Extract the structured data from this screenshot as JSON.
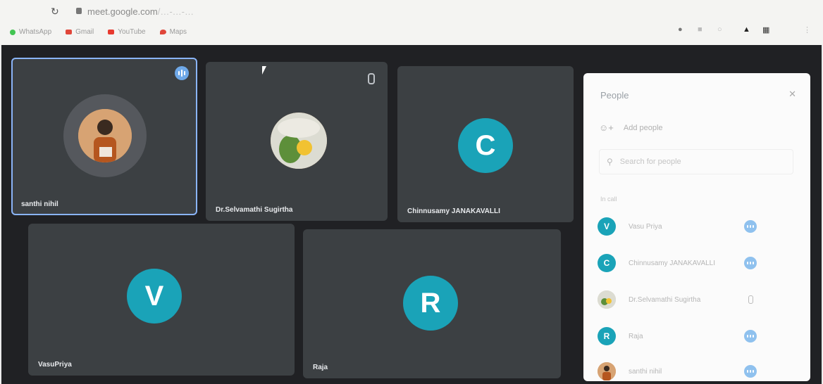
{
  "browser": {
    "url_host": "meet.google.com",
    "url_path": "/…-…-…",
    "bookmarks": [
      {
        "label": "WhatsApp",
        "color": "#43c553"
      },
      {
        "label": "Gmail",
        "color": "#e0463a"
      },
      {
        "label": "YouTube",
        "color": "#e83a2f"
      },
      {
        "label": "Maps",
        "color": "#e0463a"
      }
    ]
  },
  "tiles": [
    {
      "name": "santhi nihil",
      "kind": "photo",
      "speaking": true
    },
    {
      "name": "Dr.Selvamathi Sugirtha",
      "kind": "photo",
      "muted": true
    },
    {
      "name": "Chinnusamy JANAKAVALLI",
      "kind": "letter",
      "initial": "C"
    },
    {
      "name": "VasuPriya",
      "kind": "letter",
      "initial": "V"
    },
    {
      "name": "Raja",
      "kind": "letter",
      "initial": "R"
    }
  ],
  "people_panel": {
    "title": "People",
    "add_label": "Add people",
    "search_placeholder": "Search for people",
    "section_label": "In call",
    "participants": [
      {
        "initial": "V",
        "name": "Vasu Priya",
        "status": "speaking"
      },
      {
        "initial": "C",
        "name": "Chinnusamy JANAKAVALLI",
        "status": "speaking"
      },
      {
        "initial": "",
        "name": "Dr.Selvamathi Sugirtha",
        "status": "muted"
      },
      {
        "initial": "R",
        "name": "Raja",
        "status": "speaking"
      },
      {
        "initial": "",
        "name": "santhi nihil",
        "status": "speaking"
      }
    ]
  },
  "colors": {
    "meet_bg": "#202124",
    "tile_bg": "#3c4043",
    "avatar_teal": "#1aa3b8",
    "active_outline": "#8ab4f8"
  }
}
